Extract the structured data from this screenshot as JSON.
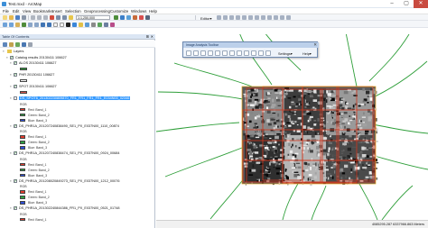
{
  "window": {
    "title": "Test.mxd - ArcMap",
    "minimize_icon": "minimize-icon",
    "maximize_icon": "maximize-icon",
    "close_icon": "close-icon"
  },
  "menu": [
    "File",
    "Edit",
    "View",
    "Bookmarks",
    "Insert",
    "Selection",
    "Geoprocessing",
    "Customize",
    "Windows",
    "Help"
  ],
  "toolbar": {
    "scale_value": "1:1,250,000",
    "editor_label": "Editor▾"
  },
  "toc": {
    "title": "Table Of Contents",
    "root_label": "Layers",
    "layers": [
      {
        "label": "Catalog results 20130411 106627",
        "checked": true,
        "kind": "group"
      },
      {
        "label": "ALOS 20130411 106627",
        "checked": true,
        "kind": "layer",
        "legend": [
          {
            "color": "#2e9e3b",
            "label": ""
          }
        ]
      },
      {
        "label": "PHR 20130411 106627",
        "checked": true,
        "kind": "layer",
        "legend": [
          {
            "color": "#ffffff",
            "label": ""
          }
        ]
      },
      {
        "label": "SPOT 20130411 106627",
        "checked": true,
        "kind": "layer",
        "legend": [
          {
            "color": "#d9534f",
            "label": ""
          }
        ]
      },
      {
        "label": "DS_SPOT6_201302230809870_FR1_FR1_FR1_FR1_E034N00_02346",
        "checked": false,
        "kind": "raster",
        "selected": true,
        "legend": [
          {
            "color": "",
            "label": "RGB"
          },
          {
            "color": "#e23b2e",
            "label": "Red:   Band_1"
          },
          {
            "color": "#2ea043",
            "label": "Green: Band_2"
          },
          {
            "color": "#2f4fd6",
            "label": "Blue:  Band_3"
          }
        ]
      },
      {
        "label": "DS_PHR1A_201207240838490_SE1_PX_E037N00_1110_00874",
        "checked": true,
        "kind": "raster",
        "legend": [
          {
            "color": "",
            "label": "RGB"
          },
          {
            "color": "#e23b2e",
            "label": "Red:   Band_1"
          },
          {
            "color": "#2ea043",
            "label": "Green: Band_2"
          },
          {
            "color": "#2f4fd6",
            "label": "Blue:  Band_3"
          }
        ]
      },
      {
        "label": "DS_PHR1A_201207240838474_SE1_PX_E037N00_0924_00684",
        "checked": true,
        "kind": "raster",
        "legend": [
          {
            "color": "",
            "label": "RGB"
          },
          {
            "color": "#e23b2e",
            "label": "Red:   Band_1"
          },
          {
            "color": "#2ea043",
            "label": "Green: Band_2"
          },
          {
            "color": "#2f4fd6",
            "label": "Blue:  Band_3"
          }
        ]
      },
      {
        "label": "DS_PHR1A_201208020849273_SE1_PX_E037N00_1212_00076",
        "checked": true,
        "kind": "raster",
        "legend": [
          {
            "color": "",
            "label": "RGB"
          },
          {
            "color": "#e23b2e",
            "label": "Red:   Band_1"
          },
          {
            "color": "#2ea043",
            "label": "Green: Band_2"
          },
          {
            "color": "#2f4fd6",
            "label": "Blue:  Band_3"
          }
        ]
      },
      {
        "label": "DS_PHR1A_201302240844386_FR1_PX_E037N00_0521_01748",
        "checked": true,
        "kind": "raster",
        "legend": [
          {
            "color": "",
            "label": "RGB"
          },
          {
            "color": "#e23b2e",
            "label": "Red:   Band_1"
          }
        ]
      }
    ]
  },
  "float_toolbar": {
    "title": "Image Analysis Toolbar",
    "settings_label": "Settings▾",
    "help_label": "Help▾"
  },
  "status": {
    "coordinates": "4085295.287   6337966.863 Meters"
  },
  "colors": {
    "accent": "#3399ff",
    "footprint": "#d0381f",
    "road": "#2f9f3a"
  }
}
